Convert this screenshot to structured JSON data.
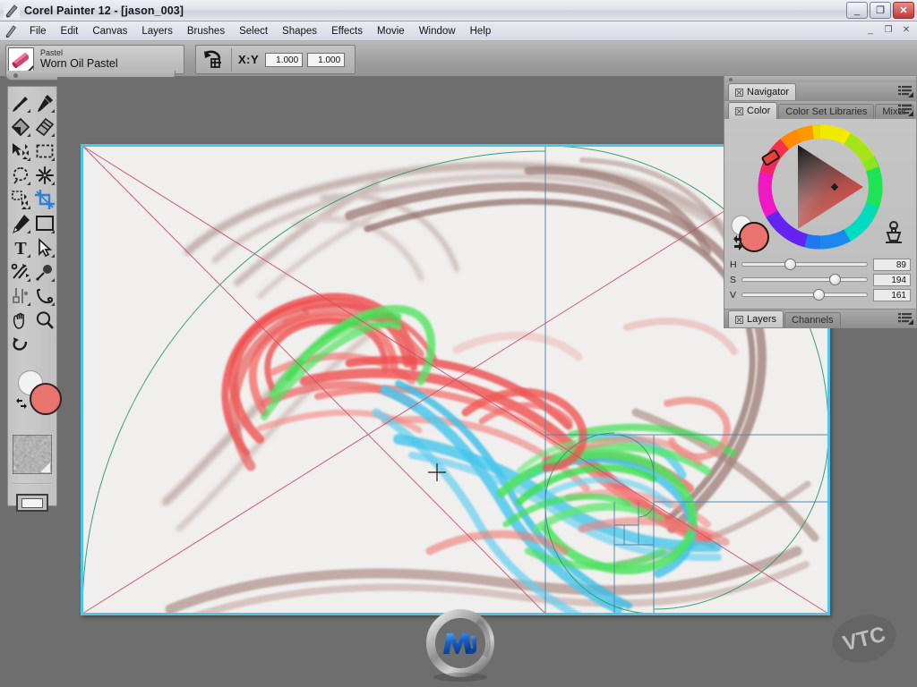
{
  "window": {
    "title": "Corel Painter 12 - [jason_003]",
    "app_icon": "brush-icon",
    "minimize_label": "_",
    "restore_label": "❐",
    "close_label": "✕",
    "mdi_minimize": "_",
    "mdi_restore": "❐",
    "mdi_close": "✕"
  },
  "menubar": {
    "items": [
      {
        "label": "File"
      },
      {
        "label": "Edit"
      },
      {
        "label": "Canvas"
      },
      {
        "label": "Layers"
      },
      {
        "label": "Brushes"
      },
      {
        "label": "Select"
      },
      {
        "label": "Shapes"
      },
      {
        "label": "Effects"
      },
      {
        "label": "Movie"
      },
      {
        "label": "Window"
      },
      {
        "label": "Help"
      }
    ]
  },
  "property_bar": {
    "brush_category": "Pastel",
    "brush_variant": "Worn Oil Pastel",
    "crop_reset_icon": "crop-reset-icon",
    "xy_label": "X:Y",
    "x_value": "1.000",
    "y_value": "1.000"
  },
  "toolbox": {
    "tools": [
      {
        "name": "brush-tool-icon",
        "active": false,
        "has_flyout": true
      },
      {
        "name": "dropper-tool-icon",
        "active": false,
        "has_flyout": true
      },
      {
        "name": "paint-bucket-tool-icon",
        "active": false,
        "has_flyout": true
      },
      {
        "name": "eraser-tool-icon",
        "active": false,
        "has_flyout": true
      },
      {
        "name": "layer-adjuster-tool-icon",
        "active": false,
        "has_flyout": true
      },
      {
        "name": "rectangular-selection-tool-icon",
        "active": false,
        "has_flyout": true
      },
      {
        "name": "lasso-tool-icon",
        "active": false,
        "has_flyout": true
      },
      {
        "name": "magic-wand-tool-icon",
        "active": false,
        "has_flyout": true
      },
      {
        "name": "selection-adjuster-tool-icon",
        "active": false,
        "has_flyout": true
      },
      {
        "name": "crop-tool-icon",
        "active": true,
        "has_flyout": false
      },
      {
        "name": "pen-tool-icon",
        "active": false,
        "has_flyout": true
      },
      {
        "name": "rectangular-shape-tool-icon",
        "active": false,
        "has_flyout": true
      },
      {
        "name": "text-tool-icon",
        "active": false,
        "has_flyout": true
      },
      {
        "name": "shape-selection-tool-icon",
        "active": false,
        "has_flyout": true
      },
      {
        "name": "scissors-tool-icon",
        "active": false,
        "has_flyout": true
      },
      {
        "name": "convert-point-tool-icon",
        "active": false,
        "has_flyout": true
      },
      {
        "name": "shape-cutter-tool-icon",
        "active": false,
        "has_flyout": true
      },
      {
        "name": "shape-editor-tool-icon",
        "active": false,
        "has_flyout": true
      },
      {
        "name": "grabber-hand-tool-icon",
        "active": false,
        "has_flyout": false
      },
      {
        "name": "magnifier-tool-icon",
        "active": false,
        "has_flyout": false
      },
      {
        "name": "rotate-page-tool-icon",
        "active": false,
        "has_flyout": false
      }
    ],
    "primary_color": "#e8736f",
    "secondary_color": "#f2f2f2",
    "swap_colors_icon": "swap-colors-icon",
    "paper_texture_icon": "paper-texture-swatch",
    "screen_mode_icon": "screen-mode-button"
  },
  "panels": {
    "navigator": {
      "tab_label": "Navigator",
      "menu_icon": "panel-menu-icon"
    },
    "color": {
      "tabs": [
        {
          "label": "Color",
          "active": true
        },
        {
          "label": "Color Set Libraries",
          "active": false
        },
        {
          "label": "Mixer",
          "active": false
        }
      ],
      "menu_icon": "panel-menu-icon",
      "clone_color_icon": "clone-color-stamp-icon",
      "primary_color": "#e8736f",
      "secondary_color": "#f2f2f2",
      "swap_icon": "swap-colors-icon",
      "sliders": [
        {
          "label": "H",
          "value": "89",
          "percent": 34
        },
        {
          "label": "S",
          "value": "194",
          "percent": 70
        },
        {
          "label": "V",
          "value": "161",
          "percent": 57
        }
      ]
    },
    "layers": {
      "tabs": [
        {
          "label": "Layers",
          "active": true
        },
        {
          "label": "Channels",
          "active": false
        }
      ],
      "menu_icon": "panel-menu-icon"
    }
  },
  "canvas": {
    "document_name": "jason_003",
    "background_color": "#f0efee",
    "guide_border_color": "#4fc3e8",
    "divine_proportion_color": "#3c7fa8",
    "diagonal_guide_color": "#c94f6d",
    "spiral_color": "#2f9a6a",
    "cursor_icon": "crosshair-cursor"
  },
  "watermarks": {
    "center_logo": "metallic-m-logo",
    "corner_badge": "VTC"
  }
}
